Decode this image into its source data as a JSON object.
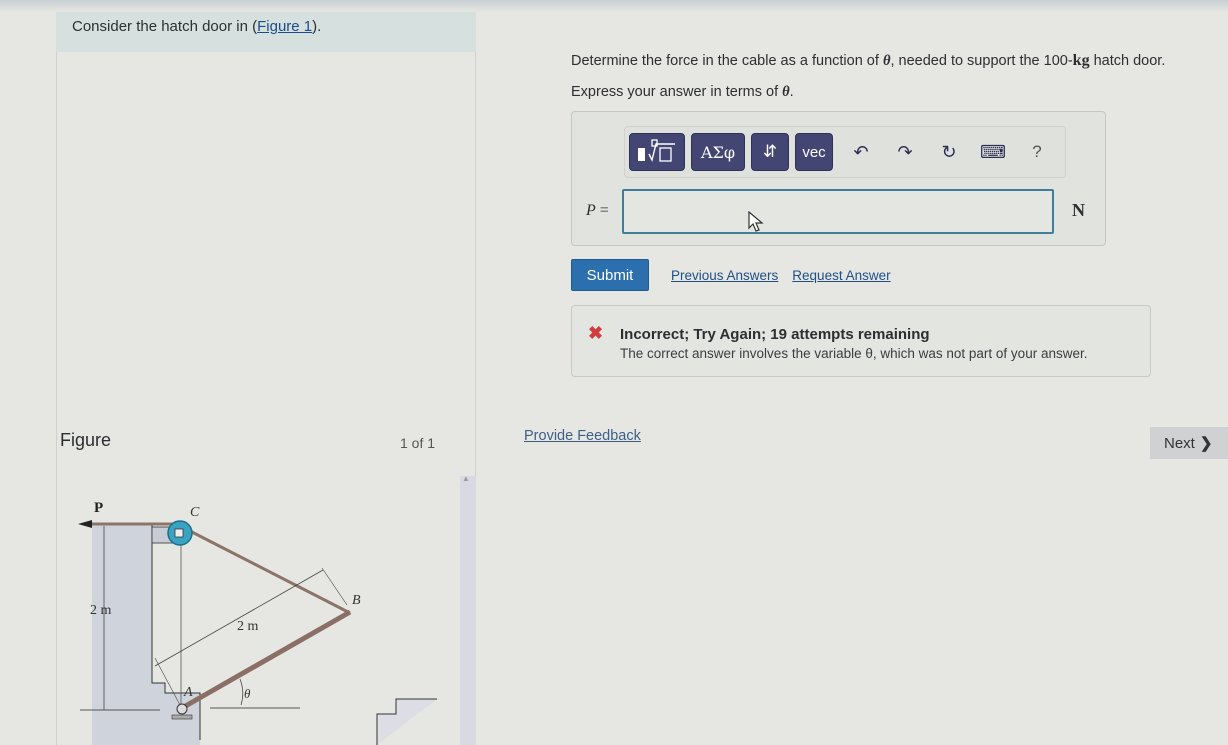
{
  "intro": {
    "text_before": "Consider the hatch door in (",
    "link_text": "Figure 1",
    "text_after": ")."
  },
  "question": {
    "line1_a": "Determine the force in the cable as a function of ",
    "line1_theta": "θ",
    "line1_b": ", needed to support the 100-",
    "line1_unit": "kg",
    "line1_c": " hatch door.",
    "line2_a": "Express your answer in terms of ",
    "line2_theta": "θ",
    "line2_b": "."
  },
  "toolbar": {
    "templates_label": "▯∜▯",
    "greek_label": "ΑΣφ",
    "arrows_label": "⇵",
    "vec_label": "vec",
    "undo_icon": "↶",
    "redo_icon": "↷",
    "reset_icon": "↻",
    "keyboard_icon": "⌨",
    "help_label": "?"
  },
  "answer": {
    "variable": "P",
    "equals": " =",
    "value": "",
    "placeholder": "",
    "unit": "N"
  },
  "actions": {
    "submit_label": "Submit",
    "previous_answers": "Previous Answers",
    "request_answer": "Request Answer"
  },
  "feedback": {
    "status_color": "#d33c3c",
    "title": "Incorrect; Try Again; 19 attempts remaining",
    "message": "The correct answer involves the variable θ, which was not part of your answer."
  },
  "figure_panel": {
    "label": "Figure",
    "count": "1 of 1",
    "labels": {
      "P": "P",
      "C": "C",
      "B": "B",
      "A": "A",
      "theta": "θ",
      "height": "2 m",
      "length": "2 m"
    }
  },
  "footer": {
    "provide_feedback": "Provide Feedback",
    "next_label": "Next",
    "next_icon": "❯"
  }
}
